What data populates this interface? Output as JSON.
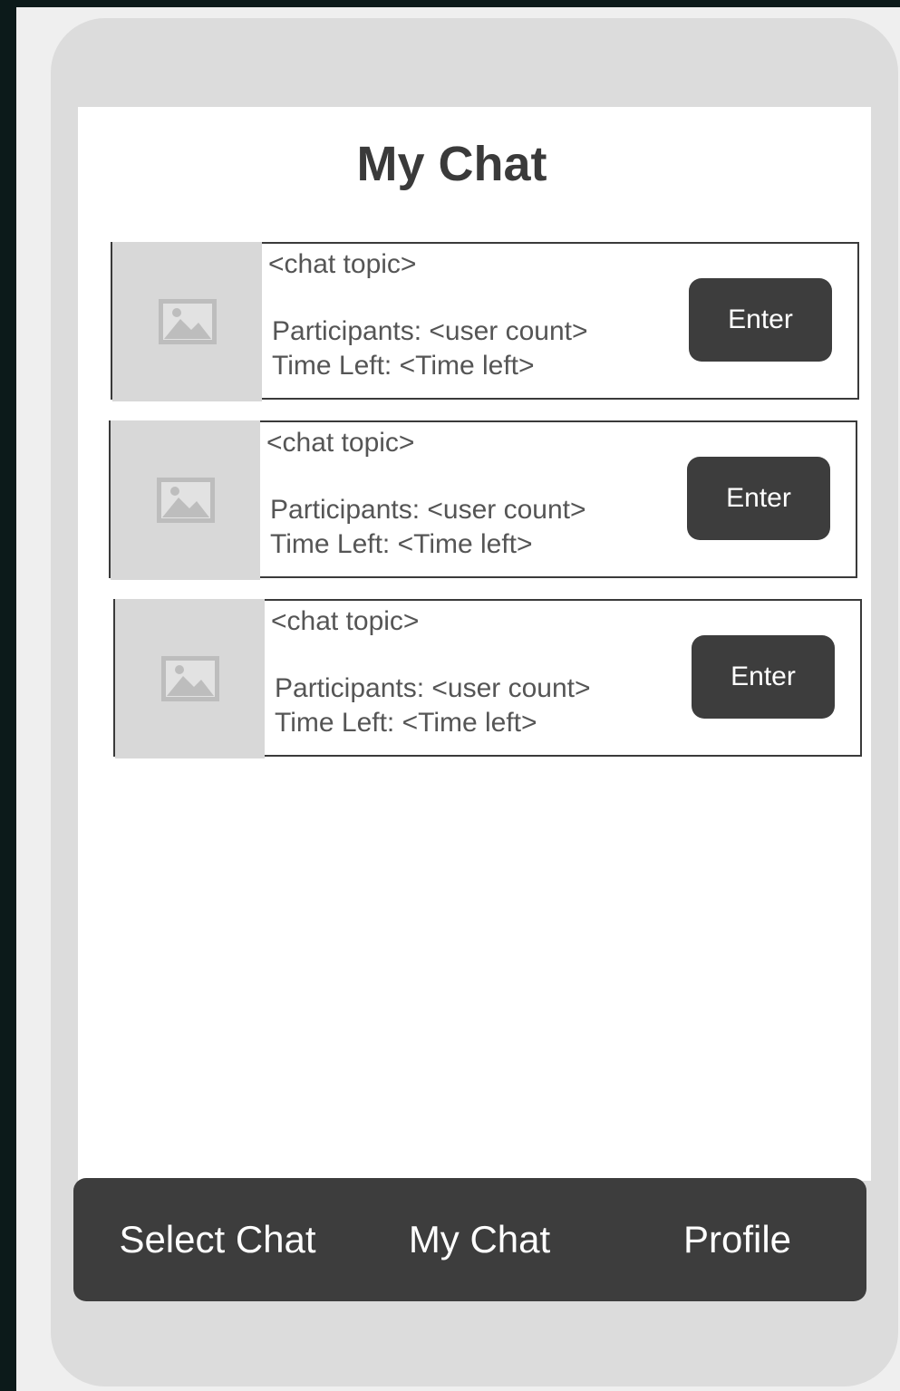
{
  "header": {
    "title": "My Chat"
  },
  "chats": [
    {
      "topic": "<chat topic>",
      "participants": "Participants: <user count>",
      "time_left": "Time Left: <Time left>",
      "enter_label": "Enter",
      "image_icon": "image-placeholder-icon"
    },
    {
      "topic": "<chat topic>",
      "participants": "Participants: <user count>",
      "time_left": "Time Left: <Time left>",
      "enter_label": "Enter",
      "image_icon": "image-placeholder-icon"
    },
    {
      "topic": "<chat topic>",
      "participants": "Participants: <user count>",
      "time_left": "Time Left: <Time left>",
      "enter_label": "Enter",
      "image_icon": "image-placeholder-icon"
    }
  ],
  "nav": {
    "select_chat": "Select Chat",
    "my_chat": "My Chat",
    "profile": "Profile"
  },
  "colors": {
    "button_bg": "#3d3d3d",
    "phone_frame": "#dcdcdc",
    "placeholder": "#d8d8d8",
    "text": "#555555"
  }
}
